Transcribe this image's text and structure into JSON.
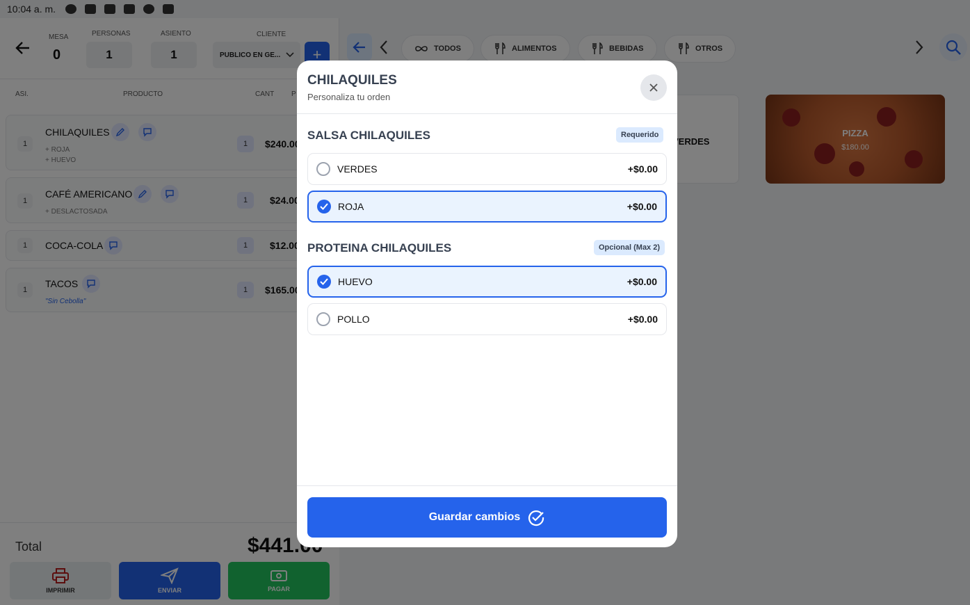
{
  "status_bar": {
    "time": "10:04 a. m."
  },
  "order_header": {
    "mesa_label": "MESA",
    "mesa_value": "0",
    "personas_label": "PERSONAS",
    "personas_value": "1",
    "asiento_label": "ASIENTO",
    "asiento_value": "1",
    "cliente_label": "CLIENTE",
    "cliente_value": "PUBLICO EN GE...",
    "add_label": "+"
  },
  "order_table": {
    "col_asi": "ASI.",
    "col_producto": "PRODUCTO",
    "col_cant": "CANT",
    "col_precio": "P",
    "items": [
      {
        "asi": "1",
        "name": "CHILAQUILES",
        "modifiers": [
          "+ ROJA",
          "+ HUEVO"
        ],
        "note": "",
        "qty": "1",
        "price": "$240.00"
      },
      {
        "asi": "1",
        "name": "CAFÉ AMERICANO",
        "modifiers": [
          "+ DESLACTOSADA"
        ],
        "note": "",
        "qty": "1",
        "price": "$24.00"
      },
      {
        "asi": "1",
        "name": "COCA-COLA",
        "modifiers": [],
        "note": "",
        "qty": "1",
        "price": "$12.00"
      },
      {
        "asi": "1",
        "name": "TACOS",
        "modifiers": [],
        "note": "\"Sin Cebolla\"",
        "qty": "1",
        "price": "$165.00"
      }
    ]
  },
  "totals": {
    "label": "Total",
    "value": "$441.00"
  },
  "actions": {
    "print": "IMPRIMIR",
    "send": "ENVIAR",
    "pay": "PAGAR"
  },
  "categories": [
    {
      "label": "TODOS",
      "icon": "infinity-icon"
    },
    {
      "label": "ALIMENTOS",
      "icon": "utensils-icon"
    },
    {
      "label": "BEBIDAS",
      "icon": "utensils-icon"
    },
    {
      "label": "OTROS",
      "icon": "utensils-icon"
    }
  ],
  "products": [
    {
      "name": "VERDES"
    },
    {
      "name": "PIZZA",
      "price": "$180.00"
    }
  ],
  "modal": {
    "title": "CHILAQUILES",
    "subtitle": "Personaliza tu orden",
    "groups": [
      {
        "title": "SALSA CHILAQUILES",
        "badge": "Requerido",
        "options": [
          {
            "name": "VERDES",
            "price": "+$0.00",
            "selected": false
          },
          {
            "name": "ROJA",
            "price": "+$0.00",
            "selected": true
          }
        ]
      },
      {
        "title": "PROTEINA CHILAQUILES",
        "badge": "Opcional (Max 2)",
        "options": [
          {
            "name": "HUEVO",
            "price": "+$0.00",
            "selected": true
          },
          {
            "name": "POLLO",
            "price": "+$0.00",
            "selected": false
          }
        ]
      }
    ],
    "save_label": "Guardar cambios"
  },
  "colors": {
    "accent": "#2563eb",
    "selected_bg": "#eaf3fe",
    "pay": "#22c55e"
  }
}
